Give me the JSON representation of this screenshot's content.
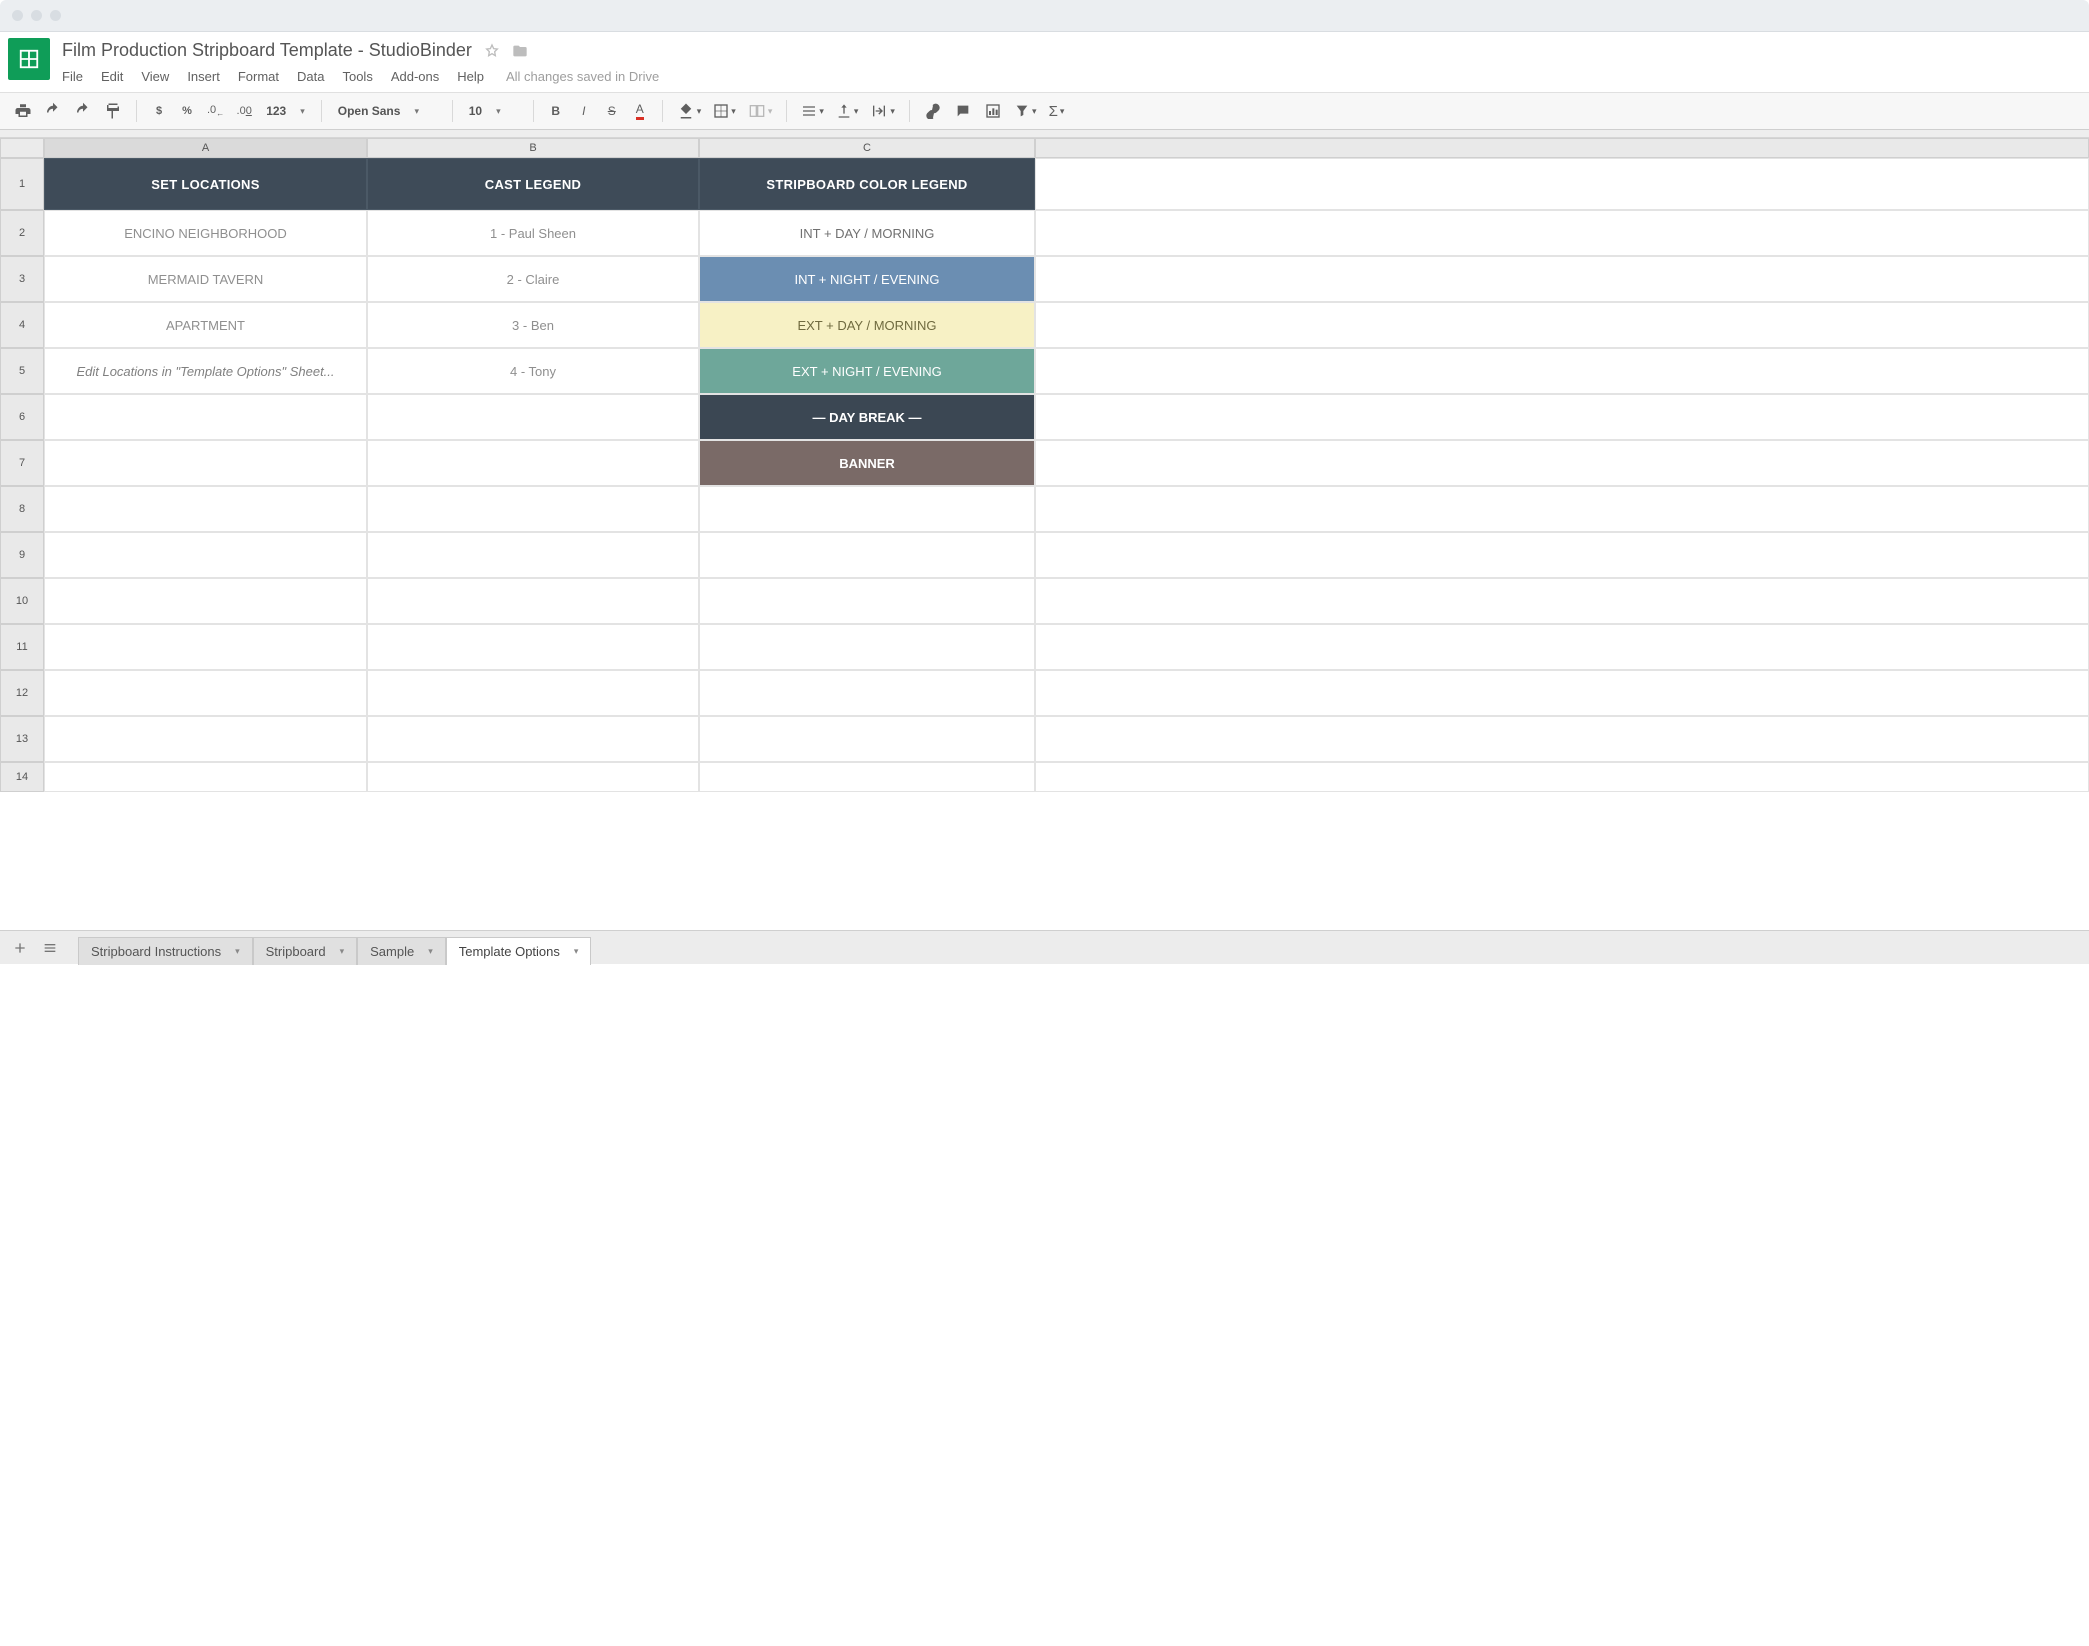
{
  "title": "Film Production Stripboard Template  -  StudioBinder",
  "status": "All changes saved in Drive",
  "menus": [
    "File",
    "Edit",
    "View",
    "Insert",
    "Format",
    "Data",
    "Tools",
    "Add-ons",
    "Help"
  ],
  "toolbar": {
    "currency": "$",
    "percent": "%",
    "dec_less": ".0",
    "dec_more": ".00",
    "num_fmt": "123",
    "font": "Open Sans",
    "font_size": "10"
  },
  "columns": [
    "A",
    "B",
    "C"
  ],
  "row_labels": [
    "1",
    "2",
    "3",
    "4",
    "5",
    "6",
    "7",
    "8",
    "9",
    "10",
    "11",
    "12",
    "13",
    "14"
  ],
  "header_row": {
    "a": "SET LOCATIONS",
    "b": "CAST LEGEND",
    "c": "STRIPBOARD COLOR LEGEND"
  },
  "rows": [
    {
      "a": "ENCINO NEIGHBORHOOD",
      "b": "1 - Paul Sheen",
      "c": "INT  +  DAY / MORNING",
      "c_class": "legend-intday"
    },
    {
      "a": "MERMAID TAVERN",
      "b": "2 - Claire",
      "c": "INT  +  NIGHT / EVENING",
      "c_class": "legend-intnight"
    },
    {
      "a": "APARTMENT",
      "b": "3 - Ben",
      "c": "EXT  +  DAY / MORNING",
      "c_class": "legend-extday"
    },
    {
      "a": "Edit Locations in \"Template Options\" Sheet...",
      "a_class": "italic",
      "b": "4 - Tony",
      "c": "EXT  +  NIGHT / EVENING",
      "c_class": "legend-extnight"
    },
    {
      "a": "",
      "b": "",
      "c": "— DAY BREAK —",
      "c_class": "legend-daybreak"
    },
    {
      "a": "",
      "b": "",
      "c": "BANNER",
      "c_class": "legend-banner"
    },
    {
      "a": "",
      "b": "",
      "c": ""
    },
    {
      "a": "",
      "b": "",
      "c": ""
    },
    {
      "a": "",
      "b": "",
      "c": ""
    },
    {
      "a": "",
      "b": "",
      "c": ""
    },
    {
      "a": "",
      "b": "",
      "c": ""
    },
    {
      "a": "",
      "b": "",
      "c": ""
    },
    {
      "a": "",
      "b": "",
      "c": ""
    }
  ],
  "tabs": [
    {
      "label": "Stripboard Instructions",
      "active": false
    },
    {
      "label": "Stripboard",
      "active": false
    },
    {
      "label": "Sample",
      "active": false
    },
    {
      "label": "Template Options",
      "active": true
    }
  ]
}
